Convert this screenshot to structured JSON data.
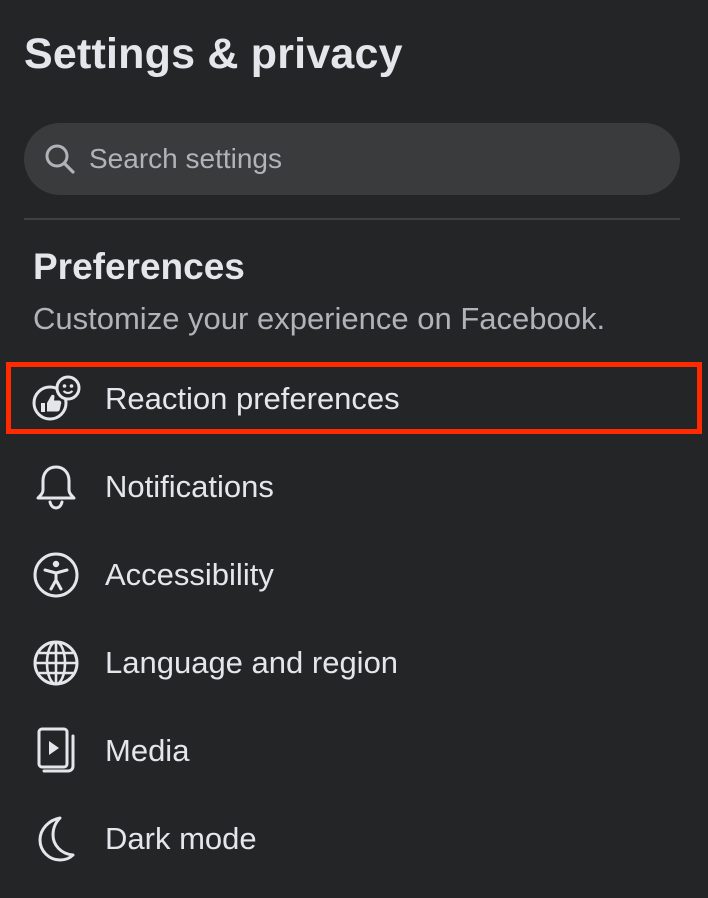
{
  "header": {
    "title": "Settings & privacy"
  },
  "search": {
    "placeholder": "Search settings",
    "value": "",
    "icon": "search-icon"
  },
  "section": {
    "heading": "Preferences",
    "subtitle": "Customize your experience on Facebook."
  },
  "menu": {
    "items": [
      {
        "label": "Reaction preferences",
        "icon": "reaction-icon",
        "highlighted": true
      },
      {
        "label": "Notifications",
        "icon": "bell-icon"
      },
      {
        "label": "Accessibility",
        "icon": "accessibility-icon"
      },
      {
        "label": "Language and region",
        "icon": "globe-icon"
      },
      {
        "label": "Media",
        "icon": "media-icon"
      },
      {
        "label": "Dark mode",
        "icon": "moon-icon"
      }
    ]
  },
  "colors": {
    "background": "#242526",
    "search_background": "#3a3b3c",
    "primary_text": "#e4e6eb",
    "secondary_text": "#b0b3b8",
    "highlight_border": "#ff2a00"
  }
}
